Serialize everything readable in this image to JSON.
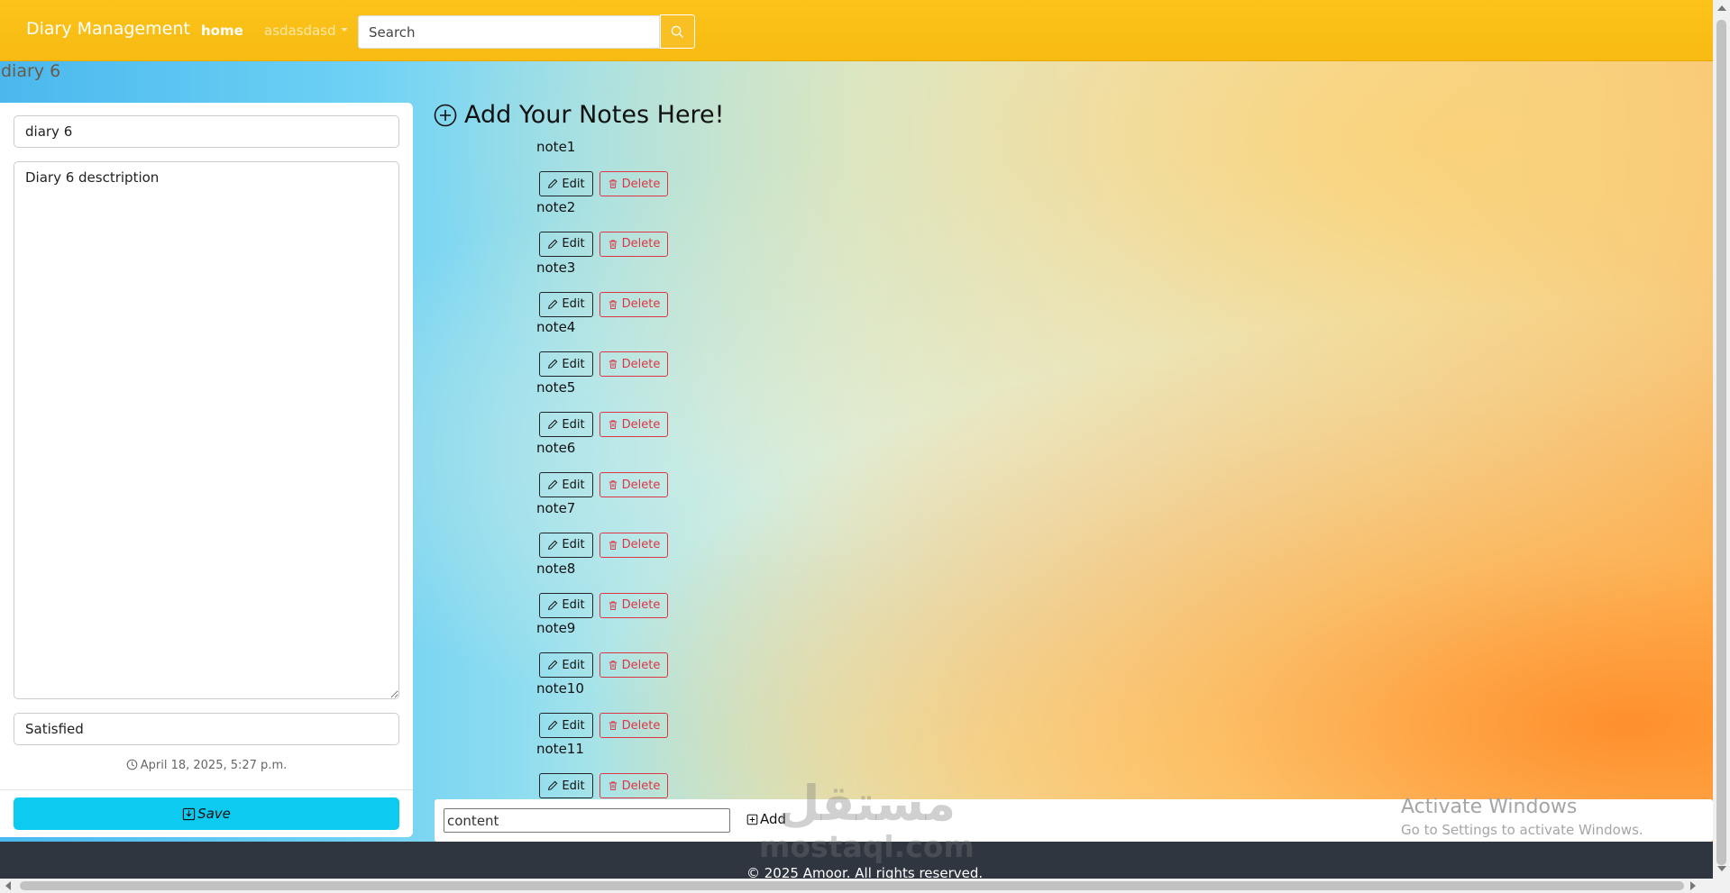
{
  "navbar": {
    "brand": "Diary Management",
    "home": "home",
    "user": "asdasdasd",
    "search_placeholder": "Search",
    "search_icon": "search-icon"
  },
  "diary": {
    "heading": "diary 6",
    "title": "diary 6",
    "description": "Diary 6 desctription",
    "mood": "Satisfied",
    "date": "April 18, 2025, 5:27 p.m.",
    "save_label": "Save"
  },
  "notes": {
    "title": "Add Your Notes Here!",
    "edit_label": "Edit",
    "delete_label": "Delete",
    "items": [
      "note1",
      "note2",
      "note3",
      "note4",
      "note5",
      "note6",
      "note7",
      "note8",
      "note9",
      "note10",
      "note11"
    ]
  },
  "add_bar": {
    "content_value": "content",
    "add_label": "Add"
  },
  "overlay": {
    "activate_title": "Activate Windows",
    "activate_sub": "Go to Settings to activate Windows."
  },
  "watermark": {
    "arabic": "مستقل",
    "latin": "mostaql.com"
  },
  "footer": {
    "text": "© 2025 Amoor. All rights reserved."
  },
  "colors": {
    "navbar": "#fcc31a",
    "save_button": "#0dcaf0",
    "delete": "#dc3545",
    "footer": "#2f3640"
  }
}
